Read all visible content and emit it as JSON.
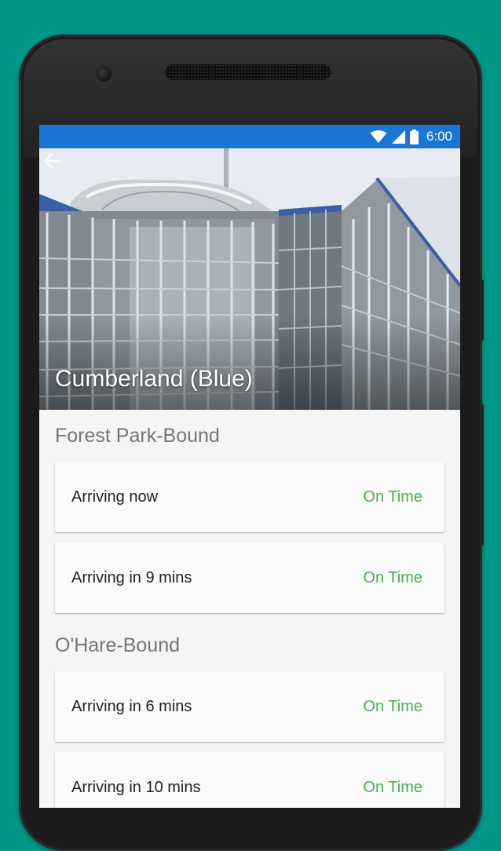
{
  "status_bar": {
    "time": "6:00",
    "icons": [
      "wifi-icon",
      "cell-signal-icon",
      "battery-icon"
    ],
    "color": "#1976d2"
  },
  "header": {
    "back_icon": "arrow-back-icon",
    "station_name": "Cumberland (Blue)"
  },
  "sections": [
    {
      "title": "Forest Park-Bound",
      "arrivals": [
        {
          "text": "Arriving now",
          "status": "On Time"
        },
        {
          "text": "Arriving in 9 mins",
          "status": "On Time"
        }
      ]
    },
    {
      "title": "O'Hare-Bound",
      "arrivals": [
        {
          "text": "Arriving in 6 mins",
          "status": "On Time"
        },
        {
          "text": "Arriving in 10 mins",
          "status": "On Time"
        }
      ]
    }
  ],
  "colors": {
    "background": "#009688",
    "status_on_time": "#4caf50",
    "section_title": "#757575"
  }
}
